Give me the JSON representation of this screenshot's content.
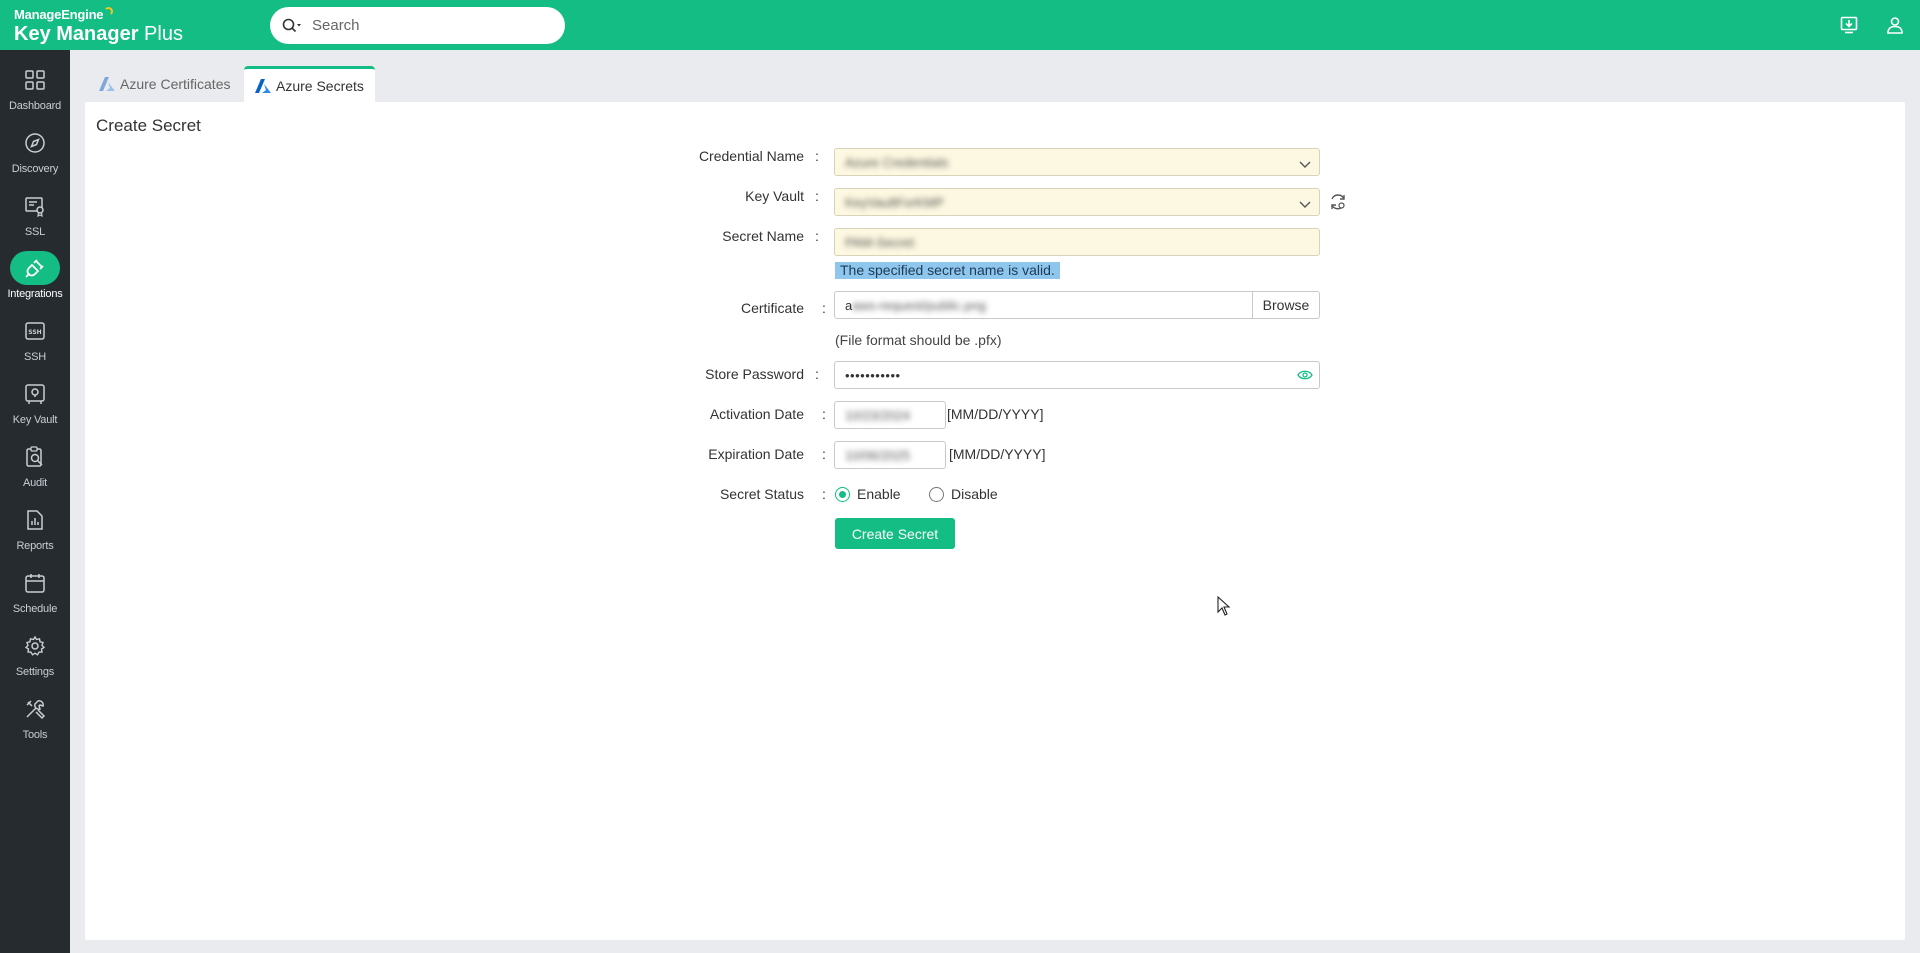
{
  "brand": {
    "company": "ManageEngine",
    "product_bold": "Key Manager",
    "product_light": " Plus"
  },
  "search": {
    "placeholder": "Search"
  },
  "sidebar": {
    "items": [
      {
        "label": "Dashboard",
        "icon": "grid-icon"
      },
      {
        "label": "Discovery",
        "icon": "compass-icon"
      },
      {
        "label": "SSL",
        "icon": "certificate-icon"
      },
      {
        "label": "Integrations",
        "icon": "plug-icon",
        "active": true
      },
      {
        "label": "SSH",
        "icon": "ssh-icon"
      },
      {
        "label": "Key Vault",
        "icon": "vault-icon"
      },
      {
        "label": "Audit",
        "icon": "audit-icon"
      },
      {
        "label": "Reports",
        "icon": "reports-icon"
      },
      {
        "label": "Schedule",
        "icon": "calendar-icon"
      },
      {
        "label": "Settings",
        "icon": "gear-icon"
      },
      {
        "label": "Tools",
        "icon": "tools-icon"
      }
    ]
  },
  "tabs": [
    {
      "label": "Azure Certificates",
      "active": false
    },
    {
      "label": "Azure Secrets",
      "active": true
    }
  ],
  "page": {
    "title": "Create Secret"
  },
  "form": {
    "credential_name": {
      "label": "Credential Name",
      "value": "Azure Credentials"
    },
    "key_vault": {
      "label": "Key Vault",
      "value": "KeyVaultForKMP"
    },
    "secret_name": {
      "label": "Secret Name",
      "value": "PAM-Secret",
      "valid_message": "The specified secret name is valid."
    },
    "certificate": {
      "label": "Certificate",
      "first_char": "a",
      "value": "aws-request/public.png",
      "browse_label": "Browse",
      "hint": "(File format should be .pfx)"
    },
    "store_password": {
      "label": "Store Password",
      "value": "•••••••••••"
    },
    "activation_date": {
      "label": "Activation Date",
      "value": "10/23/2024",
      "format": "[MM/DD/YYYY]"
    },
    "expiration_date": {
      "label": "Expiration Date",
      "value": "10/06/2025",
      "format": "[MM/DD/YYYY]"
    },
    "secret_status": {
      "label": "Secret Status",
      "enable_label": "Enable",
      "disable_label": "Disable",
      "selected": "Enable"
    },
    "submit_label": "Create Secret"
  },
  "colors": {
    "accent": "#13bd83",
    "sidebar_bg": "#262b30",
    "valid_highlight": "#8ec6ee"
  }
}
